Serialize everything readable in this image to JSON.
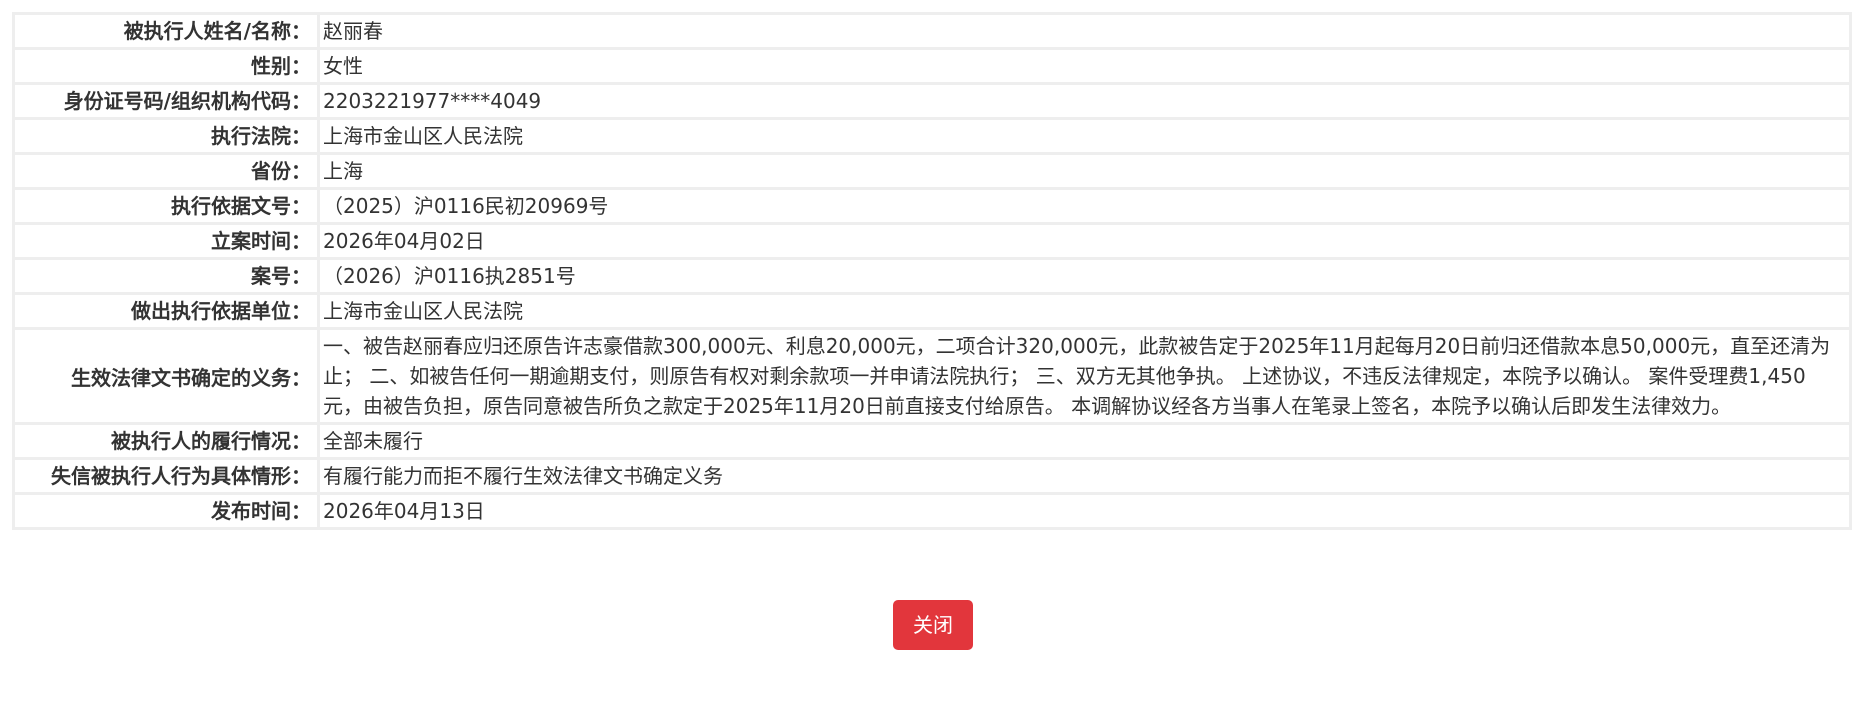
{
  "record": {
    "rows": [
      {
        "label": "被执行人姓名/名称：",
        "value": "赵丽春"
      },
      {
        "label": "性别：",
        "value": "女性"
      },
      {
        "label": "身份证号码/组织机构代码：",
        "value": "2203221977****4049"
      },
      {
        "label": "执行法院：",
        "value": "上海市金山区人民法院"
      },
      {
        "label": "省份：",
        "value": "上海"
      },
      {
        "label": "执行依据文号：",
        "value": "（2025）沪0116民初20969号"
      },
      {
        "label": "立案时间：",
        "value": "2026年04月02日"
      },
      {
        "label": "案号：",
        "value": "（2026）沪0116执2851号"
      },
      {
        "label": "做出执行依据单位：",
        "value": "上海市金山区人民法院"
      },
      {
        "label": "生效法律文书确定的义务：",
        "value": "一、被告赵丽春应归还原告许志豪借款300,000元、利息20,000元，二项合计320,000元，此款被告定于2025年11月起每月20日前归还借款本息50,000元，直至还清为止； 二、如被告任何一期逾期支付，则原告有权对剩余款项一并申请法院执行； 三、双方无其他争执。 上述协议，不违反法律规定，本院予以确认。 案件受理费1,450元，由被告负担，原告同意被告所负之款定于2025年11月20日前直接支付给原告。 本调解协议经各方当事人在笔录上签名，本院予以确认后即发生法律效力。"
      },
      {
        "label": "被执行人的履行情况：",
        "value": "全部未履行"
      },
      {
        "label": "失信被执行人行为具体情形：",
        "value": "有履行能力而拒不履行生效法律文书确定义务"
      },
      {
        "label": "发布时间：",
        "value": "2026年04月13日"
      }
    ]
  },
  "actions": {
    "close_label": "关闭"
  },
  "colors": {
    "border": "#eeeeee",
    "close_button_bg": "#e2363c",
    "text": "#333333"
  }
}
